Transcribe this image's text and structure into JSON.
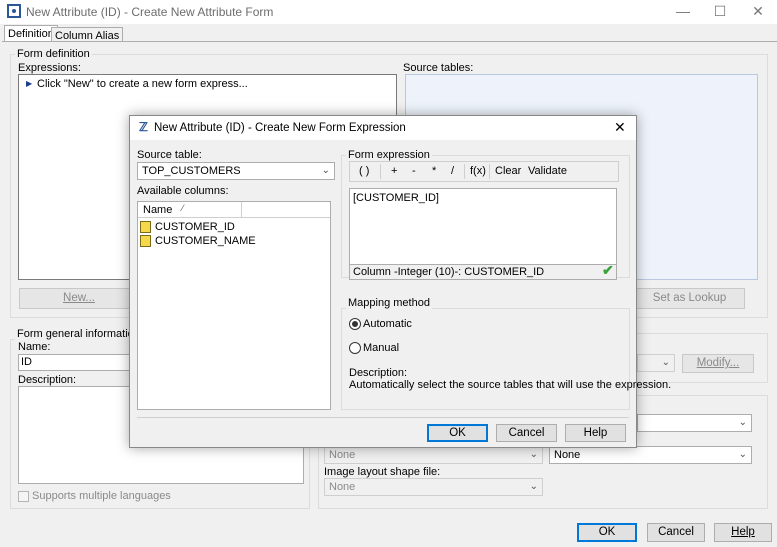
{
  "window": {
    "title": "New Attribute (ID) - Create New Attribute Form"
  },
  "tabs": [
    {
      "label": "Definition"
    },
    {
      "label": "Column Alias"
    }
  ],
  "form_definition": {
    "label": "Form definition",
    "expressions_label": "Expressions:",
    "expressions_hint": "Click \"New\" to create a new form express...",
    "source_tables_label": "Source tables:",
    "new_button": "New...",
    "set_lookup_button": "Set as Lookup"
  },
  "form_general": {
    "label": "Form general information",
    "name_label": "Name:",
    "name_value": "ID",
    "description_label": "Description:",
    "supports_multiple_languages": "Supports multiple languages"
  },
  "right_panel": {
    "modify_button": "Modify...",
    "combo_none_1": "None",
    "combo_none_2": "None",
    "image_layout_label": "Image layout shape file:",
    "combo_none_3": "None"
  },
  "footer": {
    "ok": "OK",
    "cancel": "Cancel",
    "help": "Help"
  },
  "dialog": {
    "title": "New Attribute (ID) - Create New Form Expression",
    "source_table_label": "Source table:",
    "source_table_value": "TOP_CUSTOMERS",
    "available_columns_label": "Available columns:",
    "columns_header": "Name",
    "columns": [
      {
        "name": "CUSTOMER_ID"
      },
      {
        "name": "CUSTOMER_NAME"
      }
    ],
    "form_expression_label": "Form expression",
    "toolbar": {
      "parens": "( )",
      "plus": "+",
      "minus": "-",
      "times": "*",
      "divide": "/",
      "fx": "f(x)",
      "clear": "Clear",
      "validate": "Validate"
    },
    "expression_text": "[CUSTOMER_ID]",
    "status_text": "Column -Integer (10)-: CUSTOMER_ID",
    "mapping_label": "Mapping method",
    "automatic": "Automatic",
    "manual": "Manual",
    "description_label": "Description:",
    "description_text": "Automatically select the source tables that will use the expression.",
    "ok": "OK",
    "cancel": "Cancel",
    "help": "Help"
  }
}
